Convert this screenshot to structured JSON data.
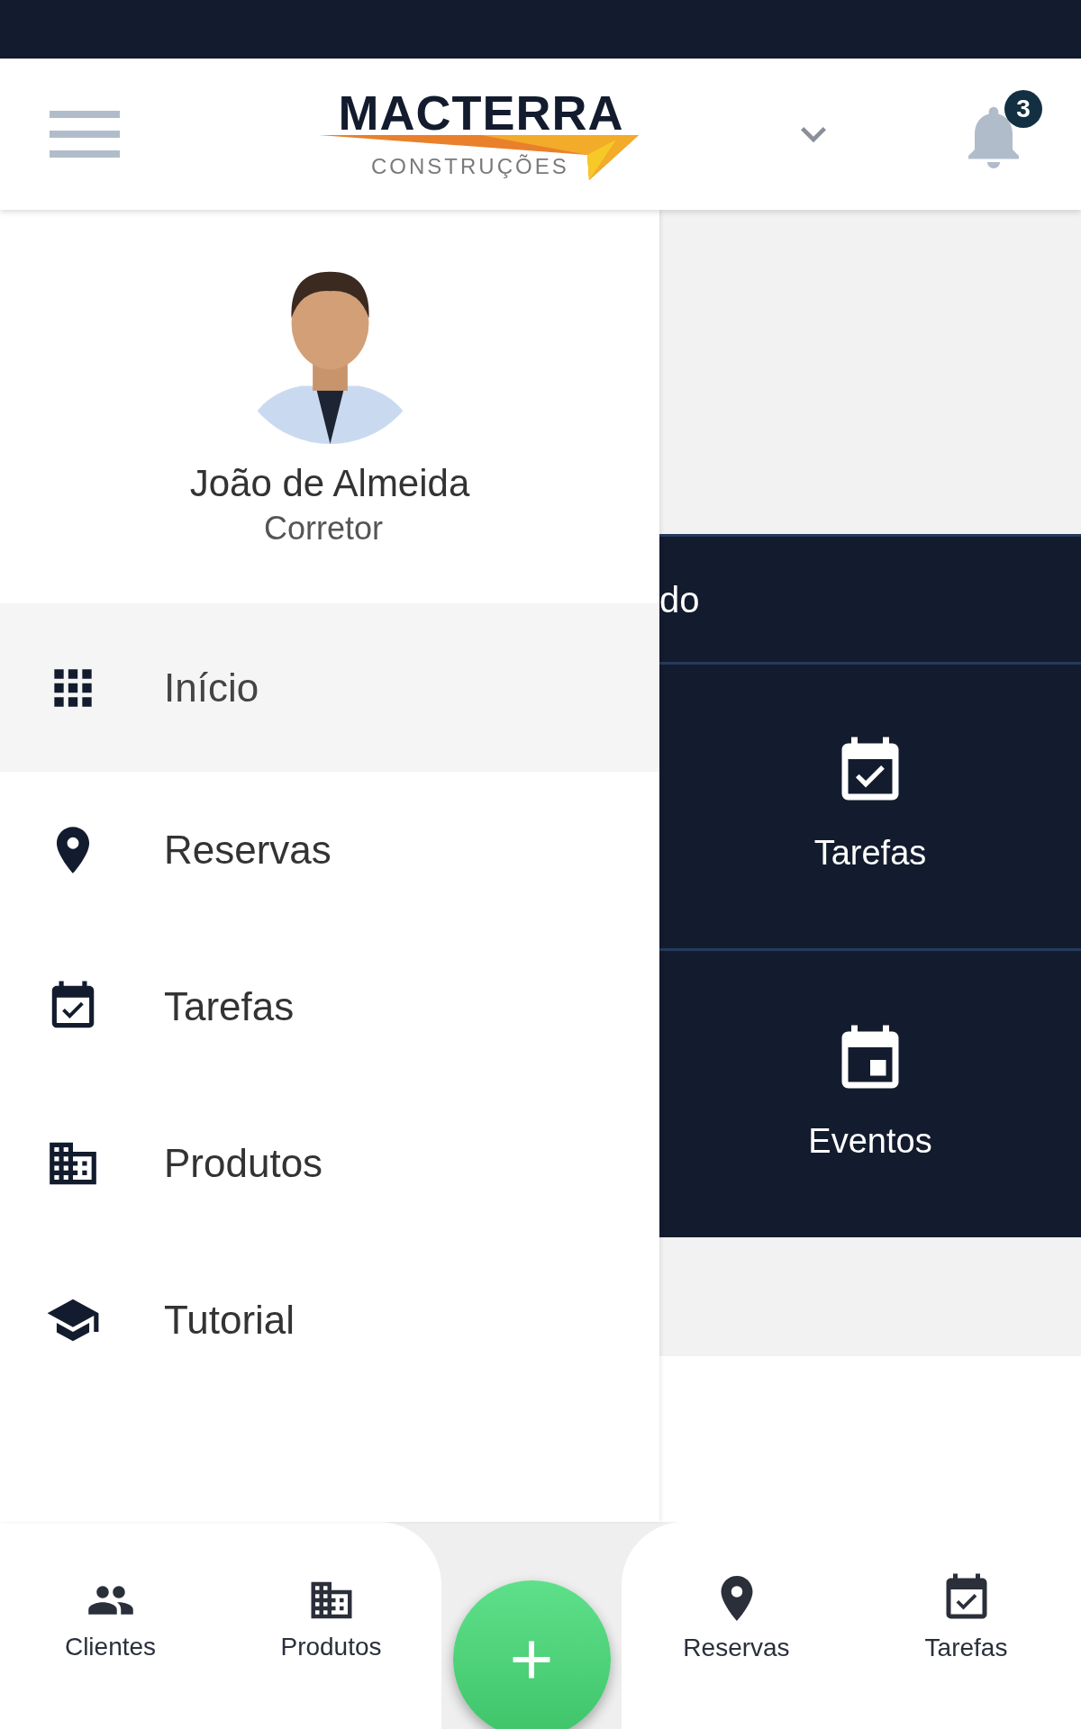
{
  "header": {
    "logo": {
      "name": "MACTERRA",
      "tagline": "CONSTRUÇÕES"
    },
    "notifications": {
      "count": "3"
    }
  },
  "drawer": {
    "user": {
      "name": "João de Almeida",
      "role": "Corretor"
    },
    "items": [
      {
        "label": "Início",
        "kind": "grid",
        "selected": true
      },
      {
        "label": "Reservas",
        "kind": "pin",
        "selected": false
      },
      {
        "label": "Tarefas",
        "kind": "tasks",
        "selected": false
      },
      {
        "label": "Produtos",
        "kind": "building",
        "selected": false
      },
      {
        "label": "Tutorial",
        "kind": "cap",
        "selected": false
      }
    ]
  },
  "content": {
    "banner": {
      "text": "do"
    },
    "cards": [
      {
        "label": "Tarefas",
        "kind": "tasks"
      },
      {
        "label": "Eventos",
        "kind": "event"
      }
    ]
  },
  "bottom_nav": {
    "left": [
      {
        "label": "Clientes",
        "kind": "people"
      },
      {
        "label": "Produtos",
        "kind": "building"
      }
    ],
    "right": [
      {
        "label": "Reservas",
        "kind": "pin"
      },
      {
        "label": "Tarefas",
        "kind": "tasks"
      }
    ]
  }
}
